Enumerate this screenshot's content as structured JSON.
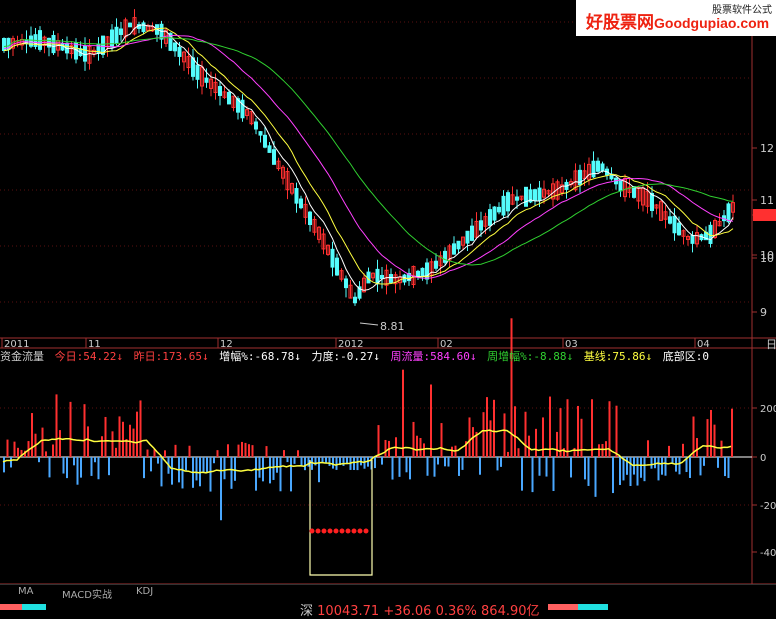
{
  "watermark": {
    "brand": "好股票网",
    "brand_url": "Goodgupiao.com",
    "subtitle": "股票软件公式"
  },
  "price_chart": {
    "low_label": "8.81",
    "y_ticks": [
      "12",
      "11",
      "11",
      "10",
      "10",
      "9"
    ],
    "x_axis_labels": [
      "2011",
      "11",
      "12",
      "2012",
      "02",
      "03",
      "04"
    ],
    "corner_label": "日"
  },
  "indicator": {
    "name": "资金流量",
    "today_label": "今日:",
    "today_value": "54.22",
    "yesterday_label": "昨日:",
    "yesterday_value": "173.65",
    "change_label": "增幅%:",
    "change_value": "-68.78",
    "force_label": "力度:",
    "force_value": "-0.27",
    "week_flow_label": "周流量:",
    "week_flow_value": "584.60",
    "week_change_label": "周增幅%:",
    "week_change_value": "-8.88",
    "baseline_label": "基线:",
    "baseline_value": "75.86",
    "zone_label": "底部区:",
    "zone_value": "0",
    "y_ticks": [
      "200",
      "0",
      "-200",
      "-40"
    ]
  },
  "tabs": [
    "MA",
    "MACD实战",
    "KDJ"
  ],
  "status": {
    "market": "深",
    "index_value": "10043.71",
    "change": "+36.06",
    "change_pct": "0.36%",
    "turnover": "864.90亿"
  },
  "colors": {
    "up": "#ff3030",
    "down": "#4aa8ff",
    "cyan_candle": "#54fcfc",
    "ma_white": "#ffffff",
    "ma_yellow": "#ffff40",
    "ma_magenta": "#ff40ff",
    "ma_green": "#30d030",
    "flow_line": "#ffff40"
  }
}
